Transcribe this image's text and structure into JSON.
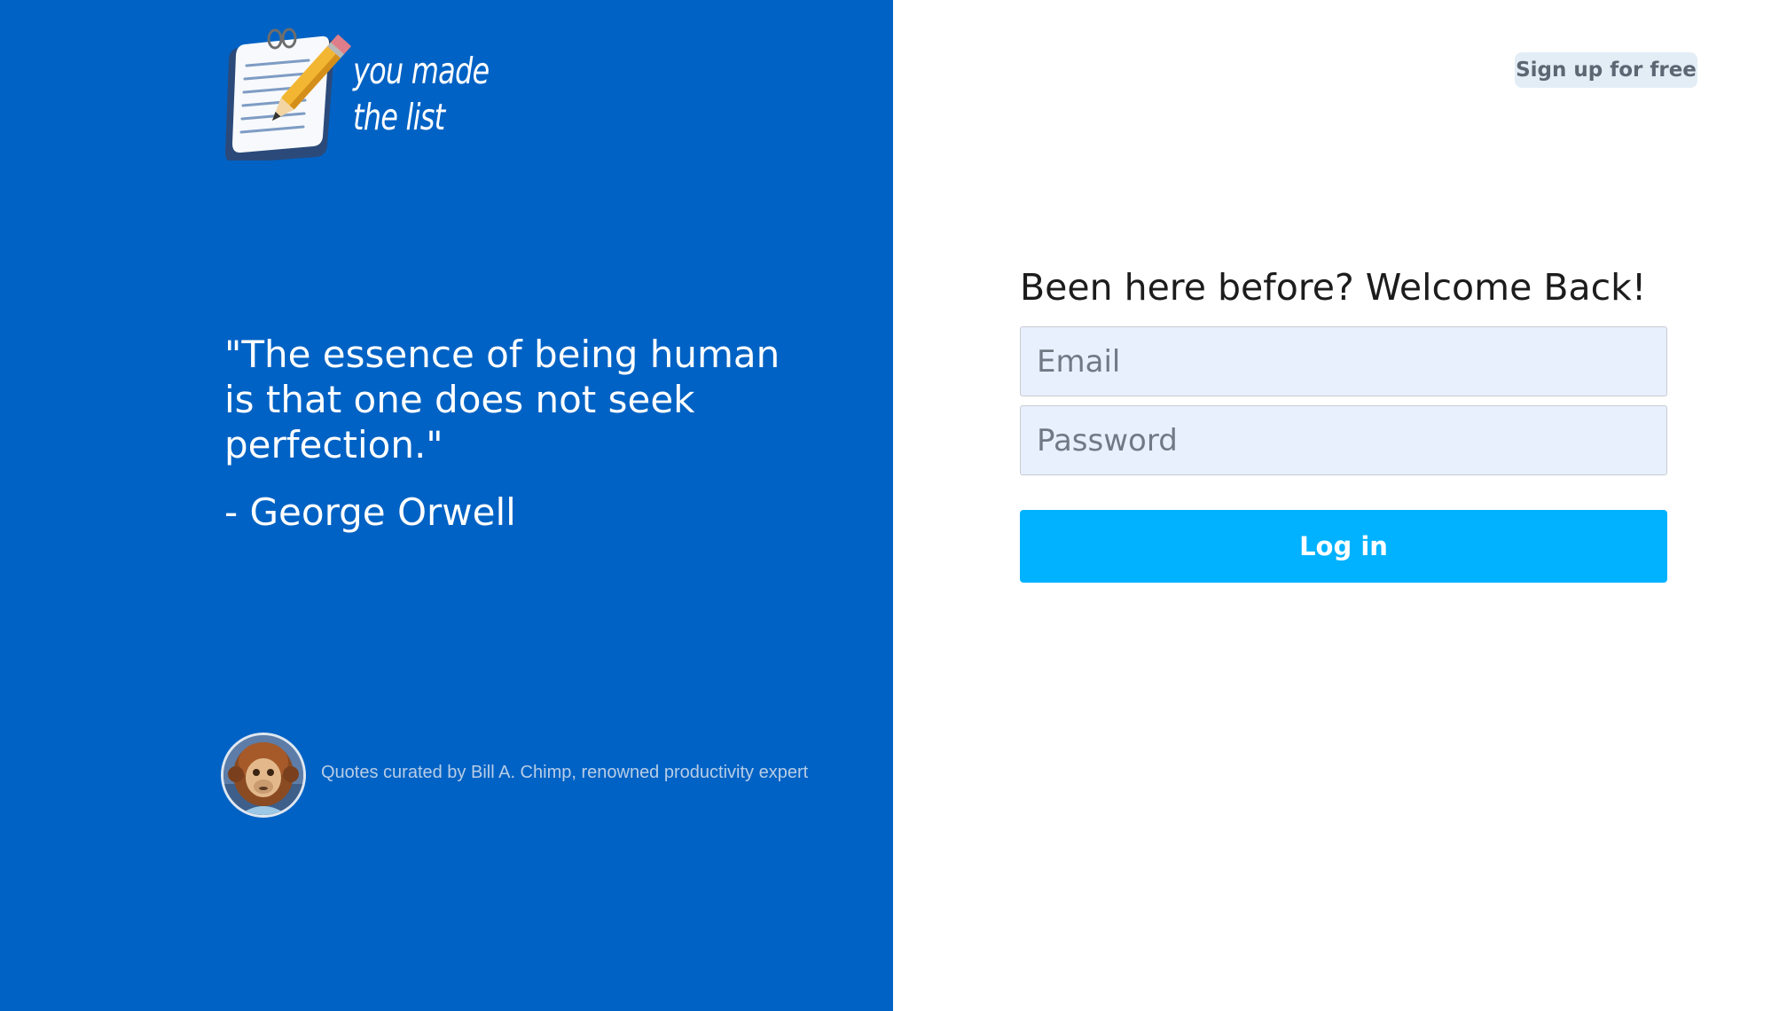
{
  "brand": {
    "logo_line_1": "you made",
    "logo_line_2": "the list",
    "icon": "notepad-pencil-icon"
  },
  "quote": {
    "text": "\"The essence of being human is that one does not seek perfection.\"",
    "author": "- George Orwell"
  },
  "curator": {
    "avatar": "chimp-avatar",
    "text": "Quotes curated by Bill A. Chimp, renowned productivity expert"
  },
  "header": {
    "signup_label": "Sign up for free"
  },
  "login": {
    "title": "Been here before? Welcome Back!",
    "email_placeholder": "Email",
    "password_placeholder": "Password",
    "submit_label": "Log in"
  },
  "colors": {
    "left_panel": "#0062c4",
    "login_button": "#00b2ff",
    "input_background": "#e8f0fe",
    "signup_background": "#e3edf6"
  }
}
